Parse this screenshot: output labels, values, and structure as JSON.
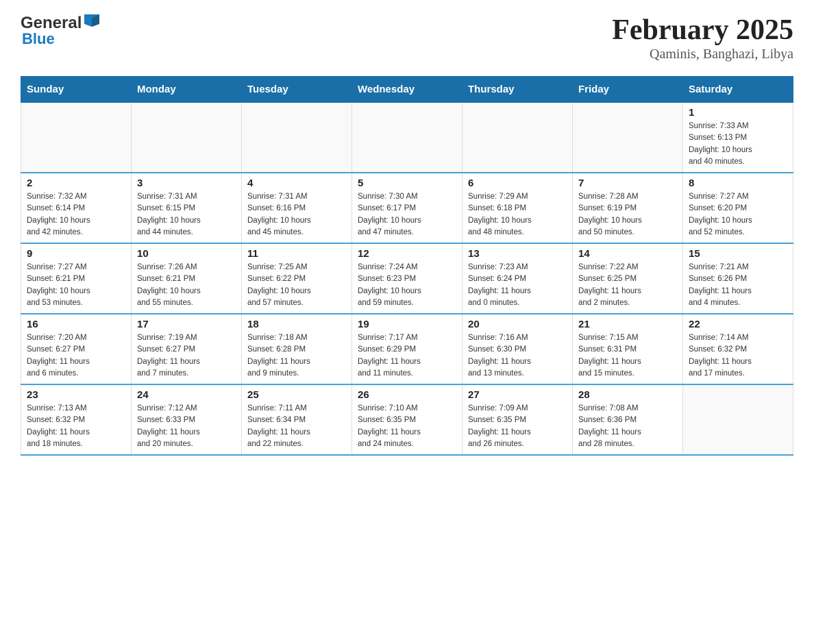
{
  "logo": {
    "name": "General",
    "accent": "Blue"
  },
  "title": "February 2025",
  "subtitle": "Qaminis, Banghazi, Libya",
  "days_of_week": [
    "Sunday",
    "Monday",
    "Tuesday",
    "Wednesday",
    "Thursday",
    "Friday",
    "Saturday"
  ],
  "weeks": [
    [
      {
        "day": "",
        "info": ""
      },
      {
        "day": "",
        "info": ""
      },
      {
        "day": "",
        "info": ""
      },
      {
        "day": "",
        "info": ""
      },
      {
        "day": "",
        "info": ""
      },
      {
        "day": "",
        "info": ""
      },
      {
        "day": "1",
        "info": "Sunrise: 7:33 AM\nSunset: 6:13 PM\nDaylight: 10 hours\nand 40 minutes."
      }
    ],
    [
      {
        "day": "2",
        "info": "Sunrise: 7:32 AM\nSunset: 6:14 PM\nDaylight: 10 hours\nand 42 minutes."
      },
      {
        "day": "3",
        "info": "Sunrise: 7:31 AM\nSunset: 6:15 PM\nDaylight: 10 hours\nand 44 minutes."
      },
      {
        "day": "4",
        "info": "Sunrise: 7:31 AM\nSunset: 6:16 PM\nDaylight: 10 hours\nand 45 minutes."
      },
      {
        "day": "5",
        "info": "Sunrise: 7:30 AM\nSunset: 6:17 PM\nDaylight: 10 hours\nand 47 minutes."
      },
      {
        "day": "6",
        "info": "Sunrise: 7:29 AM\nSunset: 6:18 PM\nDaylight: 10 hours\nand 48 minutes."
      },
      {
        "day": "7",
        "info": "Sunrise: 7:28 AM\nSunset: 6:19 PM\nDaylight: 10 hours\nand 50 minutes."
      },
      {
        "day": "8",
        "info": "Sunrise: 7:27 AM\nSunset: 6:20 PM\nDaylight: 10 hours\nand 52 minutes."
      }
    ],
    [
      {
        "day": "9",
        "info": "Sunrise: 7:27 AM\nSunset: 6:21 PM\nDaylight: 10 hours\nand 53 minutes."
      },
      {
        "day": "10",
        "info": "Sunrise: 7:26 AM\nSunset: 6:21 PM\nDaylight: 10 hours\nand 55 minutes."
      },
      {
        "day": "11",
        "info": "Sunrise: 7:25 AM\nSunset: 6:22 PM\nDaylight: 10 hours\nand 57 minutes."
      },
      {
        "day": "12",
        "info": "Sunrise: 7:24 AM\nSunset: 6:23 PM\nDaylight: 10 hours\nand 59 minutes."
      },
      {
        "day": "13",
        "info": "Sunrise: 7:23 AM\nSunset: 6:24 PM\nDaylight: 11 hours\nand 0 minutes."
      },
      {
        "day": "14",
        "info": "Sunrise: 7:22 AM\nSunset: 6:25 PM\nDaylight: 11 hours\nand 2 minutes."
      },
      {
        "day": "15",
        "info": "Sunrise: 7:21 AM\nSunset: 6:26 PM\nDaylight: 11 hours\nand 4 minutes."
      }
    ],
    [
      {
        "day": "16",
        "info": "Sunrise: 7:20 AM\nSunset: 6:27 PM\nDaylight: 11 hours\nand 6 minutes."
      },
      {
        "day": "17",
        "info": "Sunrise: 7:19 AM\nSunset: 6:27 PM\nDaylight: 11 hours\nand 7 minutes."
      },
      {
        "day": "18",
        "info": "Sunrise: 7:18 AM\nSunset: 6:28 PM\nDaylight: 11 hours\nand 9 minutes."
      },
      {
        "day": "19",
        "info": "Sunrise: 7:17 AM\nSunset: 6:29 PM\nDaylight: 11 hours\nand 11 minutes."
      },
      {
        "day": "20",
        "info": "Sunrise: 7:16 AM\nSunset: 6:30 PM\nDaylight: 11 hours\nand 13 minutes."
      },
      {
        "day": "21",
        "info": "Sunrise: 7:15 AM\nSunset: 6:31 PM\nDaylight: 11 hours\nand 15 minutes."
      },
      {
        "day": "22",
        "info": "Sunrise: 7:14 AM\nSunset: 6:32 PM\nDaylight: 11 hours\nand 17 minutes."
      }
    ],
    [
      {
        "day": "23",
        "info": "Sunrise: 7:13 AM\nSunset: 6:32 PM\nDaylight: 11 hours\nand 18 minutes."
      },
      {
        "day": "24",
        "info": "Sunrise: 7:12 AM\nSunset: 6:33 PM\nDaylight: 11 hours\nand 20 minutes."
      },
      {
        "day": "25",
        "info": "Sunrise: 7:11 AM\nSunset: 6:34 PM\nDaylight: 11 hours\nand 22 minutes."
      },
      {
        "day": "26",
        "info": "Sunrise: 7:10 AM\nSunset: 6:35 PM\nDaylight: 11 hours\nand 24 minutes."
      },
      {
        "day": "27",
        "info": "Sunrise: 7:09 AM\nSunset: 6:35 PM\nDaylight: 11 hours\nand 26 minutes."
      },
      {
        "day": "28",
        "info": "Sunrise: 7:08 AM\nSunset: 6:36 PM\nDaylight: 11 hours\nand 28 minutes."
      },
      {
        "day": "",
        "info": ""
      }
    ]
  ]
}
